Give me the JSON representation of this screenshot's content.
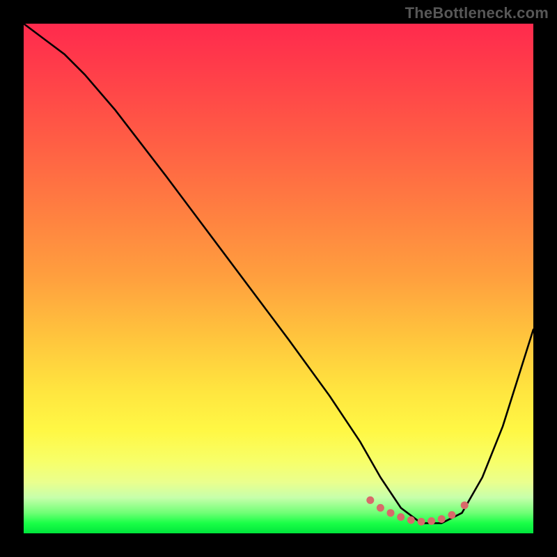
{
  "watermark": "TheBottleneck.com",
  "chart_data": {
    "type": "line",
    "title": "",
    "xlabel": "",
    "ylabel": "",
    "xlim": [
      0,
      100
    ],
    "ylim": [
      0,
      100
    ],
    "grid": false,
    "series": [
      {
        "name": "curve",
        "stroke": "#000000",
        "stroke_width": 2.6,
        "x": [
          0,
          4,
          8,
          12,
          18,
          28,
          40,
          52,
          60,
          66,
          70,
          74,
          78,
          82,
          86,
          90,
          94,
          100
        ],
        "y": [
          100,
          97,
          94,
          90,
          83,
          70,
          54,
          38,
          27,
          18,
          11,
          5,
          2,
          2,
          4,
          11,
          21,
          40
        ]
      }
    ],
    "annotations": [
      {
        "name": "min-region-markers",
        "type": "scatter",
        "color": "#d86a6a",
        "radius": 5.5,
        "points": [
          {
            "x": 68,
            "y": 6.5
          },
          {
            "x": 70,
            "y": 5.0
          },
          {
            "x": 72,
            "y": 4.0
          },
          {
            "x": 74,
            "y": 3.2
          },
          {
            "x": 76,
            "y": 2.6
          },
          {
            "x": 78,
            "y": 2.3
          },
          {
            "x": 80,
            "y": 2.4
          },
          {
            "x": 82,
            "y": 2.8
          },
          {
            "x": 84,
            "y": 3.6
          },
          {
            "x": 86.5,
            "y": 5.5
          }
        ]
      }
    ],
    "gradient_colors": {
      "top": "#ff2a4d",
      "mid_upper": "#ff7d41",
      "mid": "#ffe53f",
      "mid_lower": "#eaff8e",
      "bottom": "#00e63c"
    }
  }
}
